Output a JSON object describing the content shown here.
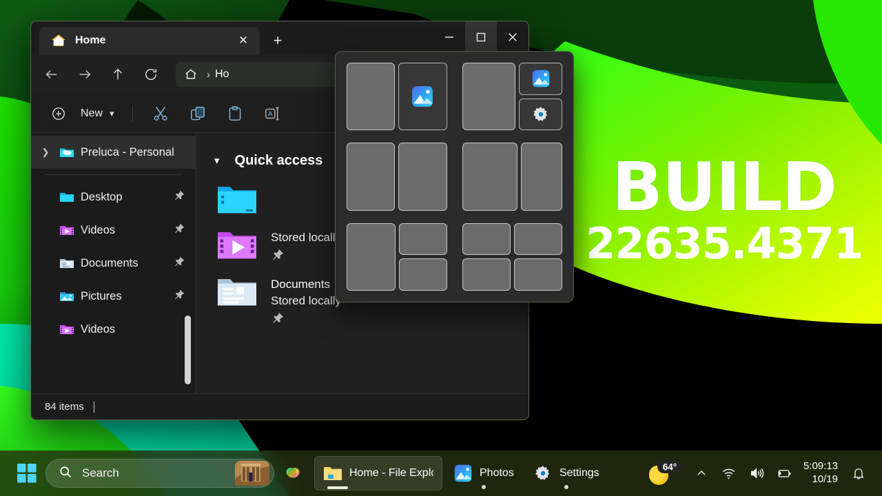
{
  "wallpaper": {
    "name": "windows-abstract-green-bloom",
    "colors": [
      "#000000",
      "#0a3d0a",
      "#16c60c",
      "#3ff000",
      "#c8ff00",
      "#eaff00",
      "#00d0a0",
      "#0b6b2a"
    ]
  },
  "overlay_text": {
    "build_word": "BUILD",
    "build_number": "22635.4371"
  },
  "explorer": {
    "tab": {
      "title": "Home",
      "icon": "home-folder-icon",
      "close_label": "✕"
    },
    "new_tab_label": "+",
    "window_controls": {
      "minimize": "–",
      "maximize": "☐",
      "close": "✕",
      "maximize_state": "hovered"
    },
    "nav": {
      "back": "←",
      "forward": "→",
      "up": "↑",
      "refresh": "↻"
    },
    "address": {
      "home_icon": "home-icon",
      "separator": "›",
      "crumb": "Ho"
    },
    "command_bar": {
      "new_label": "New",
      "new_chevron": "⌄",
      "items": [
        "cut-icon",
        "copy-icon",
        "paste-icon",
        "rename-icon"
      ]
    },
    "sidebar": {
      "items": [
        {
          "label": "Preluca - Personal",
          "icon": "onedrive-folder-icon",
          "expandable": true,
          "selected": true,
          "pinned": false
        },
        {
          "label": "Desktop",
          "icon": "desktop-folder-icon",
          "expandable": false,
          "selected": false,
          "pinned": true
        },
        {
          "label": "Videos",
          "icon": "videos-folder-icon",
          "expandable": false,
          "selected": false,
          "pinned": true
        },
        {
          "label": "Documents",
          "icon": "documents-folder-icon",
          "expandable": false,
          "selected": false,
          "pinned": true
        },
        {
          "label": "Pictures",
          "icon": "pictures-folder-icon",
          "expandable": false,
          "selected": false,
          "pinned": true
        },
        {
          "label": "Videos",
          "icon": "videos-folder-icon",
          "expandable": false,
          "selected": false,
          "pinned": false
        }
      ]
    },
    "content": {
      "section_title": "Quick access",
      "section_chevron": "⌄",
      "items": [
        {
          "name": "",
          "subtitle": "",
          "icon": "desktop-folder-icon",
          "pinned": true
        },
        {
          "name": "",
          "subtitle": "Stored locally",
          "icon": "videos-folder-icon",
          "pinned": true
        },
        {
          "name": "Documents",
          "subtitle": "Stored locally",
          "icon": "documents-folder-icon",
          "pinned": true
        }
      ]
    },
    "status": {
      "text": "84 items"
    }
  },
  "snap_flyout": {
    "name": "snap-layouts-flyout",
    "layouts": [
      {
        "id": "two-column-equal",
        "zones": [
          {
            "kind": "plain"
          },
          {
            "kind": "app",
            "icon": "photos-icon"
          }
        ]
      },
      {
        "id": "left-large-right-stacked",
        "zones": [
          {
            "kind": "plain"
          },
          {
            "kind": "app",
            "icon": "photos-icon"
          },
          {
            "kind": "app",
            "icon": "settings-gear-icon"
          }
        ]
      },
      {
        "id": "three-column-equal",
        "zones": [
          {
            "kind": "plain"
          },
          {
            "kind": "plain"
          }
        ]
      },
      {
        "id": "left-wide-right-narrow",
        "zones": [
          {
            "kind": "plain"
          },
          {
            "kind": "plain"
          }
        ]
      },
      {
        "id": "left-large-right-two-stack",
        "zones": [
          {
            "kind": "plain"
          },
          {
            "kind": "plain"
          },
          {
            "kind": "plain"
          }
        ]
      },
      {
        "id": "quad-grid",
        "zones": [
          {
            "kind": "plain"
          },
          {
            "kind": "plain"
          },
          {
            "kind": "plain"
          },
          {
            "kind": "plain"
          }
        ]
      }
    ]
  },
  "taskbar": {
    "start": {
      "icon": "windows-start-icon"
    },
    "search": {
      "placeholder": "Search",
      "icon": "search-icon",
      "thumbnail": "abu-simbel-temple-thumbnail"
    },
    "copilot": {
      "icon": "copilot-icon"
    },
    "apps": [
      {
        "label": "Home - File Explor",
        "icon": "file-explorer-icon",
        "active": true,
        "running": true
      },
      {
        "label": "Photos",
        "icon": "photos-icon",
        "active": false,
        "running": true
      },
      {
        "label": "Settings",
        "icon": "settings-gear-icon",
        "active": false,
        "running": true
      }
    ],
    "tray": {
      "weather": {
        "temperature": "64°",
        "icon": "sunny-icon"
      },
      "chevron": "⌃",
      "icons": [
        "wifi-icon",
        "volume-icon",
        "battery-icon"
      ],
      "clock": {
        "time": "5:09:13",
        "date": "10/19"
      },
      "notifications": "bell-icon"
    }
  }
}
